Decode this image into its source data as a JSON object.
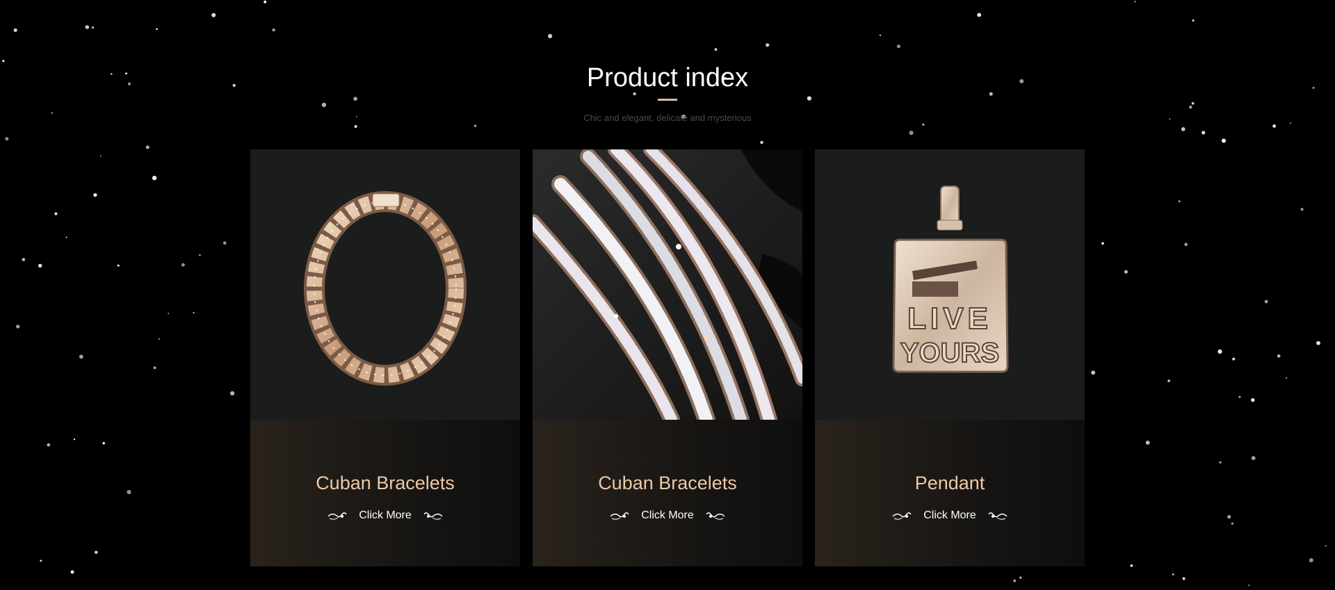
{
  "section": {
    "title": "Product index",
    "subtitle": "Chic and elegant, delicate and mysterious"
  },
  "products": [
    {
      "name": "Cuban Bracelets",
      "more_label": "Click More",
      "image": "cuban-chain-necklace"
    },
    {
      "name": "Cuban Bracelets",
      "more_label": "Click More",
      "image": "tennis-bracelets"
    },
    {
      "name": "Pendant",
      "more_label": "Click More",
      "image": "live-yours-pendant"
    }
  ],
  "pendant_text": [
    "LIVE",
    "YOURS"
  ],
  "colors": {
    "background": "#000000",
    "accent": "#ecc9a6",
    "card": "#1b1c1c"
  },
  "icons": [
    "ornament-left-icon",
    "ornament-right-icon"
  ]
}
